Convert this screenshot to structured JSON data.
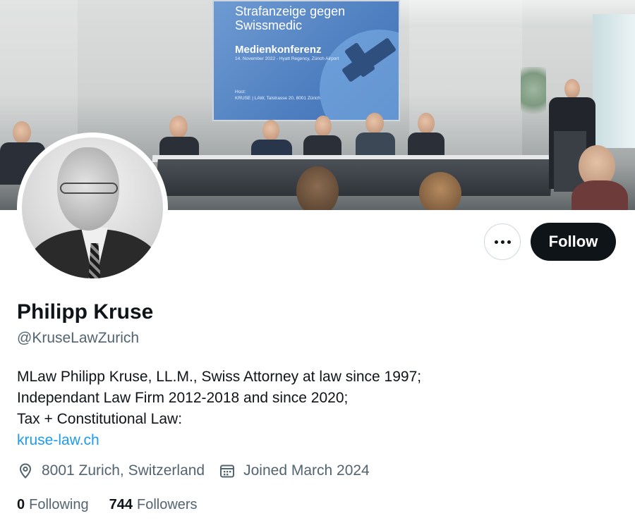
{
  "banner": {
    "screen": {
      "title": "Strafanzeige gegen Swissmedic",
      "subtitle": "Medienkonferenz",
      "date_line": "14. November 2022 - Hyatt Regency, Zürich Airport",
      "host_label": "Host:",
      "host_line": "KRUSE | LAW, Talstrasse 20, 8001 Zürich"
    }
  },
  "profile": {
    "name": "Philipp Kruse",
    "handle": "@KruseLawZurich",
    "bio_lines": [
      "MLaw Philipp Kruse, LL.M., Swiss Attorney at law since 1997;",
      "Independant Law Firm 2012-2018 and since 2020;",
      "Tax + Constitutional Law:"
    ],
    "website": "kruse-law.ch",
    "location": "8001 Zurich, Switzerland",
    "joined": "Joined March 2024",
    "location_icon": "location-pin-icon",
    "calendar_icon": "calendar-icon"
  },
  "actions": {
    "more_icon": "more-horizontal-icon",
    "follow_label": "Follow"
  },
  "stats": {
    "following_count": "0",
    "following_label": "Following",
    "followers_count": "744",
    "followers_label": "Followers"
  }
}
